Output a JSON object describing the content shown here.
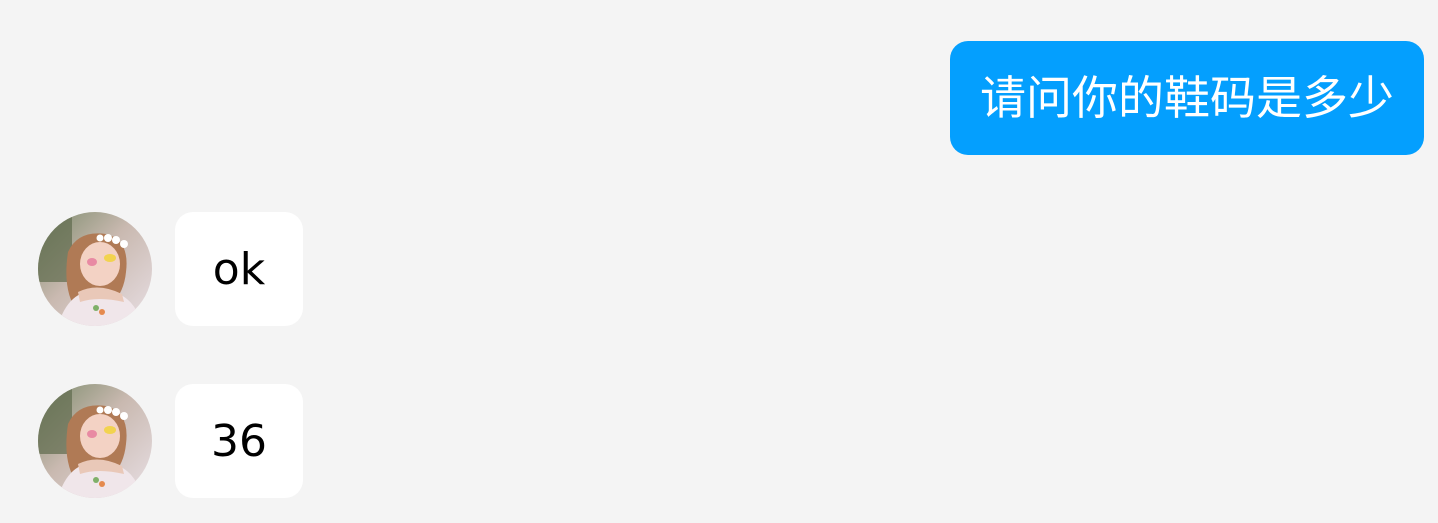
{
  "colors": {
    "background": "#f4f4f4",
    "outgoing_bubble": "#049ffe",
    "outgoing_text": "#ffffff",
    "incoming_bubble": "#ffffff",
    "incoming_text": "#000000"
  },
  "messages": [
    {
      "direction": "outgoing",
      "text": "请问你的鞋码是多少"
    },
    {
      "direction": "incoming",
      "text": "ok",
      "avatar": "contact-avatar-photo"
    },
    {
      "direction": "incoming",
      "text": "36",
      "avatar": "contact-avatar-photo"
    }
  ]
}
